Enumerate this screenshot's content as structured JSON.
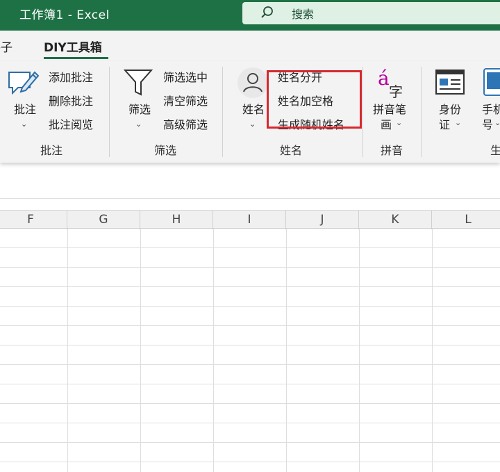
{
  "window": {
    "title": "工作簿1  -  Excel"
  },
  "search": {
    "label": "搜索"
  },
  "tabs": {
    "previous_partial": "格子",
    "active": "DIY工具箱"
  },
  "groups": {
    "comments": {
      "big_button": "批注",
      "items": [
        "添加批注",
        "删除批注",
        "批注阅览"
      ],
      "label": "批注"
    },
    "filter": {
      "big_button": "筛选",
      "items": [
        "筛选选中",
        "清空筛选",
        "高级筛选"
      ],
      "label": "筛选"
    },
    "name": {
      "big_button": "姓名",
      "items": [
        "姓名分开",
        "姓名加空格",
        "生成随机姓名"
      ],
      "label": "姓名"
    },
    "pinyin": {
      "icon_glyph_a": "á",
      "icon_glyph_zi": "字",
      "big_button_line1": "拼音笔",
      "big_button_line2": "画",
      "label": "拼音"
    },
    "id": {
      "big_button_line1": "身份",
      "big_button_line2": "证"
    },
    "phone": {
      "big_button_line1": "手机",
      "big_button_line2": "号",
      "label_partial": "生"
    }
  },
  "sheet": {
    "columns": [
      "F",
      "G",
      "H",
      "I",
      "J",
      "K",
      "L"
    ]
  },
  "colors": {
    "accent": "#1e7145",
    "highlight": "#d6282e",
    "pinyin_accent": "#b4009e",
    "phone_icon": "#2e75b6"
  }
}
